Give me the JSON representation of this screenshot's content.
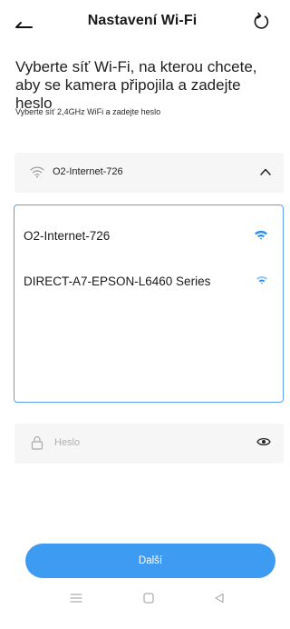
{
  "header": {
    "title": "Nastavení Wi-Fi",
    "back_icon": "back-arrow-icon",
    "refresh_icon": "refresh-icon"
  },
  "instruction": "Vyberte síť Wi-Fi, na kterou chcete, aby se kamera připojila a zadejte heslo",
  "subinstruction": "Vyberte síť 2,4GHz WiFi a zadejte heslo",
  "selected_network": {
    "ssid": "O2-Internet-726",
    "icon": "wifi-icon",
    "expand_icon": "chevron-up-icon"
  },
  "networks": [
    {
      "name": "O2-Internet-726",
      "icon": "wifi-signal-icon"
    },
    {
      "name": "DIRECT-A7-EPSON-L6460 Series",
      "icon": "wifi-signal-icon"
    }
  ],
  "password": {
    "placeholder": "Heslo",
    "value": "",
    "lock_icon": "lock-icon",
    "eye_icon": "eye-icon"
  },
  "next_button": "Další",
  "system_nav": {
    "menu_icon": "menu-icon",
    "home_icon": "home-square-icon",
    "back_icon": "back-triangle-icon"
  },
  "colors": {
    "accent": "#3e9bf2",
    "list_border": "#5b9ff1",
    "field_bg": "#f6f6f6",
    "wifi_signal": "#2f8ff0"
  }
}
